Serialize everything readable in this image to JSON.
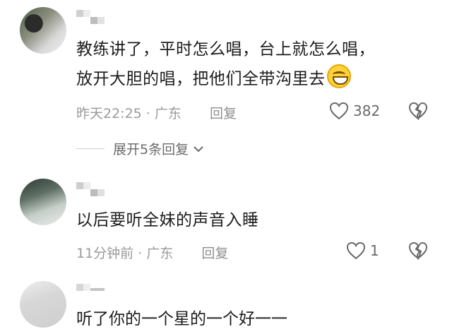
{
  "comments": [
    {
      "text_line1": "教练讲了，平时怎么唱，台上就怎么唱，",
      "text_line2": "放开大胆的唱，把他们全带沟里去",
      "emoji": "grinning-face",
      "time": "昨天22:25",
      "location": "广东",
      "reply_label": "回复",
      "likes": "382",
      "expand_label": "展开5条回复"
    },
    {
      "text_line1": "以后要听全妹的声音入睡",
      "time": "11分钟前",
      "location": "广东",
      "reply_label": "回复",
      "likes": "1"
    },
    {
      "partial_text": "听了你的一个星的一个好一一"
    }
  ],
  "separator": " · "
}
